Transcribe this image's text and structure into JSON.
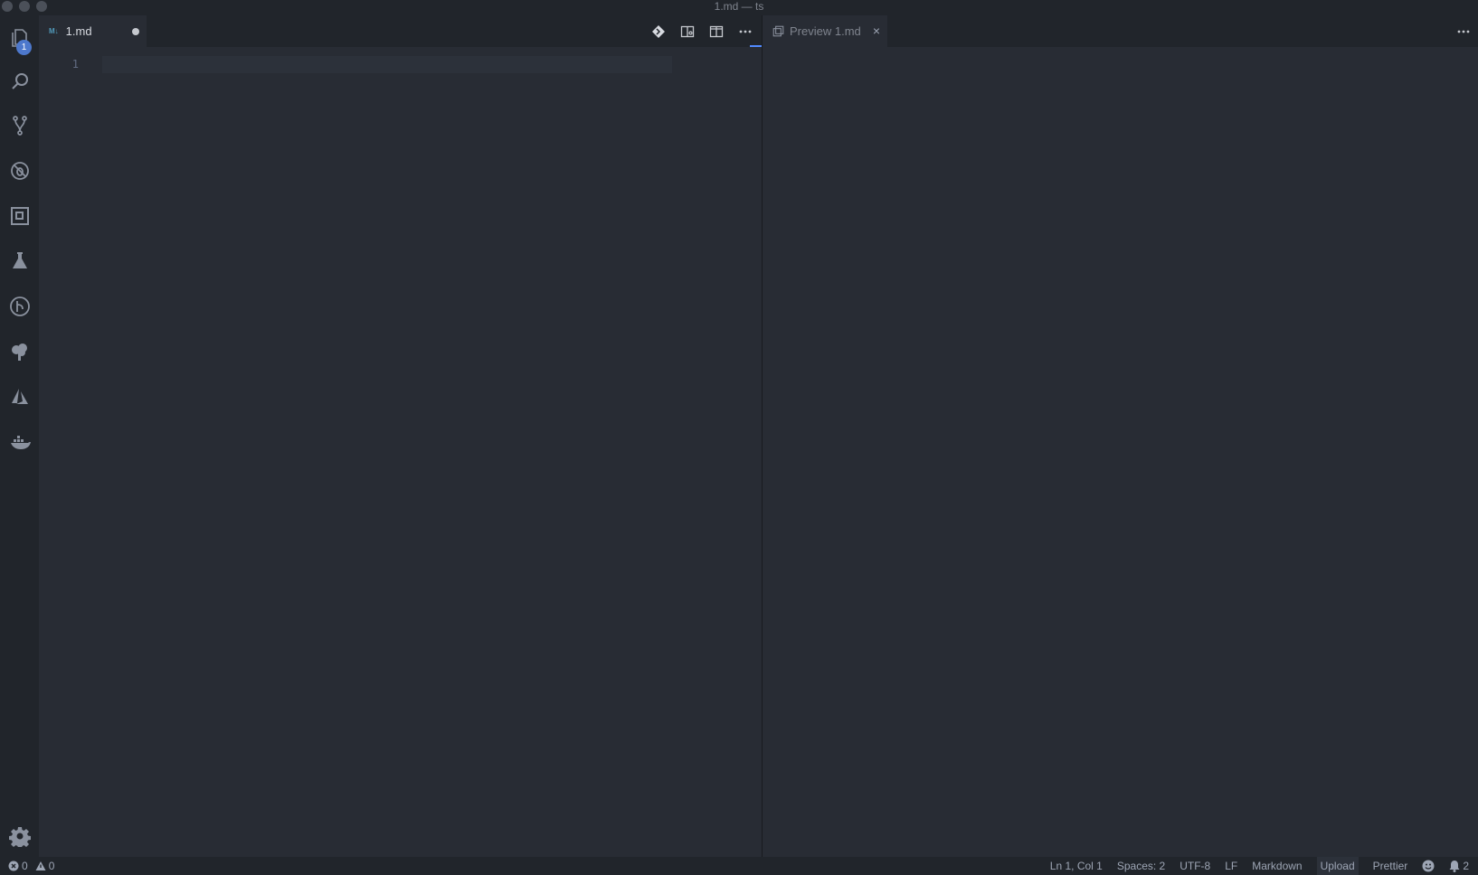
{
  "window": {
    "title": "1.md — ts"
  },
  "activity_bar": {
    "items": [
      {
        "icon": "explorer-icon",
        "badge": "1"
      },
      {
        "icon": "search-icon"
      },
      {
        "icon": "source-control-icon"
      },
      {
        "icon": "debug-icon"
      },
      {
        "icon": "extensions-icon"
      },
      {
        "icon": "test-flask-icon"
      },
      {
        "icon": "gitlens-icon"
      },
      {
        "icon": "tree-icon"
      },
      {
        "icon": "azure-icon"
      },
      {
        "icon": "docker-icon"
      }
    ],
    "settings_icon": "gear-icon"
  },
  "left_editor": {
    "tab": {
      "badge": "M↓",
      "label": "1.md",
      "dirty": true
    },
    "line_numbers": [
      "1"
    ],
    "actions": [
      "open-changes-icon",
      "open-preview-to-side-icon",
      "split-editor-icon",
      "more-actions-icon"
    ]
  },
  "right_editor": {
    "tab": {
      "label": "Preview 1.md",
      "close": "×"
    },
    "actions": [
      "more-actions-icon"
    ]
  },
  "status_bar": {
    "errors": "0",
    "warnings": "0",
    "cursor": "Ln 1, Col 1",
    "indent": "Spaces: 2",
    "encoding": "UTF-8",
    "eol": "LF",
    "language": "Markdown",
    "upload": "Upload",
    "formatter": "Prettier",
    "notifications": "2"
  },
  "colors": {
    "background": "#282c34",
    "chrome": "#21252b",
    "accent": "#528bff",
    "badge": "#4d78cc"
  }
}
